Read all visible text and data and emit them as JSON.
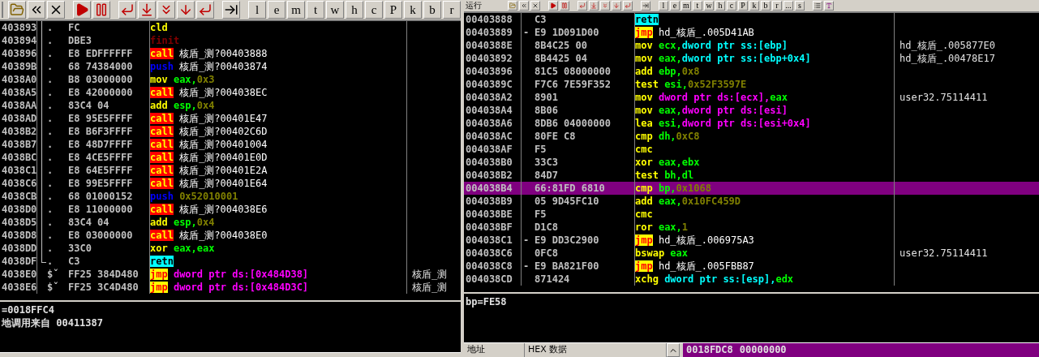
{
  "left_pane": {
    "toolbar": {
      "letters": [
        "l",
        "e",
        "m",
        "t",
        "w",
        "h",
        "c",
        "P",
        "k",
        "b",
        "r"
      ]
    },
    "rows": [
      {
        "address": "403893",
        "marker": {
          "text": ".",
          "kind": "block"
        },
        "bytes": "FC",
        "instruction": [
          {
            "text": "cld",
            "kind": "op"
          }
        ]
      },
      {
        "address": "403894",
        "marker": {
          "text": ".",
          "kind": "block"
        },
        "bytes": "DBE3",
        "instruction": [
          {
            "text": "finit",
            "kind": "fpu"
          }
        ]
      },
      {
        "address": "403896",
        "marker": {
          "text": ".",
          "kind": "block"
        },
        "bytes": "E8 EDFFFFFF",
        "instruction": [
          {
            "text": "call",
            "kind": "call"
          },
          {
            "text": " 核盾_测?00403888",
            "kind": "label"
          }
        ]
      },
      {
        "address": "40389B",
        "marker": {
          "text": ".",
          "kind": "block"
        },
        "bytes": "68 74384000",
        "instruction": [
          {
            "text": "push",
            "kind": "push"
          },
          {
            "text": " 核盾_测?00403874",
            "kind": "label"
          }
        ]
      },
      {
        "address": "4038A0",
        "marker": {
          "text": ".",
          "kind": "block"
        },
        "bytes": "B8 03000000",
        "instruction": [
          {
            "text": "mov",
            "kind": "op"
          },
          {
            "text": " eax,",
            "kind": "reg"
          },
          {
            "text": "0x3",
            "kind": "imm"
          }
        ]
      },
      {
        "address": "4038A5",
        "marker": {
          "text": ".",
          "kind": "block"
        },
        "bytes": "E8 42000000",
        "instruction": [
          {
            "text": "call",
            "kind": "call"
          },
          {
            "text": " 核盾_测?004038EC",
            "kind": "label"
          }
        ]
      },
      {
        "address": "4038AA",
        "marker": {
          "text": ".",
          "kind": "block"
        },
        "bytes": "83C4 04",
        "instruction": [
          {
            "text": "add",
            "kind": "op"
          },
          {
            "text": " esp,",
            "kind": "reg"
          },
          {
            "text": "0x4",
            "kind": "imm"
          }
        ]
      },
      {
        "address": "4038AD",
        "marker": {
          "text": ".",
          "kind": "block"
        },
        "bytes": "E8 95E5FFFF",
        "instruction": [
          {
            "text": "call",
            "kind": "call"
          },
          {
            "text": " 核盾_测?00401E47",
            "kind": "label"
          }
        ]
      },
      {
        "address": "4038B2",
        "marker": {
          "text": ".",
          "kind": "block"
        },
        "bytes": "E8 B6F3FFFF",
        "instruction": [
          {
            "text": "call",
            "kind": "call"
          },
          {
            "text": " 核盾_测?00402C6D",
            "kind": "label"
          }
        ]
      },
      {
        "address": "4038B7",
        "marker": {
          "text": ".",
          "kind": "block"
        },
        "bytes": "E8 48D7FFFF",
        "instruction": [
          {
            "text": "call",
            "kind": "call"
          },
          {
            "text": " 核盾_测?00401004",
            "kind": "label"
          }
        ]
      },
      {
        "address": "4038BC",
        "marker": {
          "text": ".",
          "kind": "block"
        },
        "bytes": "E8 4CE5FFFF",
        "instruction": [
          {
            "text": "call",
            "kind": "call"
          },
          {
            "text": " 核盾_测?00401E0D",
            "kind": "label"
          }
        ]
      },
      {
        "address": "4038C1",
        "marker": {
          "text": ".",
          "kind": "block"
        },
        "bytes": "E8 64E5FFFF",
        "instruction": [
          {
            "text": "call",
            "kind": "call"
          },
          {
            "text": " 核盾_测?00401E2A",
            "kind": "label"
          }
        ]
      },
      {
        "address": "4038C6",
        "marker": {
          "text": ".",
          "kind": "block"
        },
        "bytes": "E8 99E5FFFF",
        "instruction": [
          {
            "text": "call",
            "kind": "call"
          },
          {
            "text": " 核盾_测?00401E64",
            "kind": "label"
          }
        ]
      },
      {
        "address": "4038CB",
        "marker": {
          "text": ".",
          "kind": "block"
        },
        "bytes": "68 01000152",
        "instruction": [
          {
            "text": "push",
            "kind": "push"
          },
          {
            "text": " 0x52010001",
            "kind": "imm"
          }
        ]
      },
      {
        "address": "4038D0",
        "marker": {
          "text": ".",
          "kind": "block"
        },
        "bytes": "E8 11000000",
        "instruction": [
          {
            "text": "call",
            "kind": "call"
          },
          {
            "text": " 核盾_测?004038E6",
            "kind": "label"
          }
        ]
      },
      {
        "address": "4038D5",
        "marker": {
          "text": ".",
          "kind": "block"
        },
        "bytes": "83C4 04",
        "instruction": [
          {
            "text": "add",
            "kind": "op"
          },
          {
            "text": " esp,",
            "kind": "reg"
          },
          {
            "text": "0x4",
            "kind": "imm"
          }
        ]
      },
      {
        "address": "4038D8",
        "marker": {
          "text": ".",
          "kind": "block"
        },
        "bytes": "E8 03000000",
        "instruction": [
          {
            "text": "call",
            "kind": "call"
          },
          {
            "text": " 核盾_测?004038E0",
            "kind": "label"
          }
        ]
      },
      {
        "address": "4038DD",
        "marker": {
          "text": ".",
          "kind": "block"
        },
        "bytes": "33C0",
        "instruction": [
          {
            "text": "xor",
            "kind": "op"
          },
          {
            "text": " eax,eax",
            "kind": "reg"
          }
        ]
      },
      {
        "address": "4038DF",
        "marker": {
          "text": ".",
          "kind": "end"
        },
        "bytes": "C3",
        "instruction": [
          {
            "text": "retn",
            "kind": "retn"
          }
        ]
      },
      {
        "address": "4038E0",
        "marker": {
          "text": "$ˇ",
          "kind": "entry"
        },
        "bytes": "FF25 384D480",
        "instruction": [
          {
            "text": "jmp",
            "kind": "jmp"
          },
          {
            "text": " dword ptr ds:[0x484D38]",
            "kind": "mem"
          }
        ],
        "comment": "核盾_测"
      },
      {
        "address": "4038E6",
        "marker": {
          "text": "$ˇ",
          "kind": "entry"
        },
        "bytes": "FF25 3C4D480",
        "instruction": [
          {
            "text": "jmp",
            "kind": "jmp"
          },
          {
            "text": " dword ptr ds:[0x484D3C]",
            "kind": "mem"
          }
        ],
        "comment": "核盾_测"
      }
    ],
    "info": [
      "=0018FFC4",
      "地调用来自 00411387"
    ]
  },
  "right_pane": {
    "toolbar": {
      "status": "运行",
      "letters": [
        "l",
        "e",
        "m",
        "t",
        "w",
        "h",
        "c",
        "P",
        "k",
        "b",
        "r",
        "...",
        "s"
      ]
    },
    "rows": [
      {
        "address": "00403888",
        "bytes": "C3",
        "instruction": [
          {
            "text": "retn",
            "kind": "retn"
          }
        ],
        "selected": false
      },
      {
        "address": "00403889",
        "marker": {
          "text": "-",
          "kind": "jump"
        },
        "bytes": "E9 1D091D00",
        "instruction": [
          {
            "text": "jmp",
            "kind": "jmp"
          },
          {
            "text": " hd_核盾_.005D41AB",
            "kind": "label"
          }
        ],
        "selected": false
      },
      {
        "address": "0040388E",
        "bytes": "8B4C25 00",
        "instruction": [
          {
            "text": "mov",
            "kind": "op"
          },
          {
            "text": " ecx,",
            "kind": "reg"
          },
          {
            "text": "dword ptr ss:[ebp]",
            "kind": "stack"
          }
        ],
        "comment": "hd_核盾_.005877E0",
        "selected": false
      },
      {
        "address": "00403892",
        "bytes": "8B4425 04",
        "instruction": [
          {
            "text": "mov",
            "kind": "op"
          },
          {
            "text": " eax,",
            "kind": "reg"
          },
          {
            "text": "dword ptr ss:[ebp+0x4]",
            "kind": "stack"
          }
        ],
        "comment": "hd_核盾_.00478E17",
        "selected": false
      },
      {
        "address": "00403896",
        "bytes": "81C5 08000000",
        "instruction": [
          {
            "text": "add",
            "kind": "op"
          },
          {
            "text": " ebp,",
            "kind": "reg"
          },
          {
            "text": "0x8",
            "kind": "imm"
          }
        ],
        "selected": false
      },
      {
        "address": "0040389C",
        "bytes": "F7C6 7E59F352",
        "instruction": [
          {
            "text": "test",
            "kind": "op"
          },
          {
            "text": " esi,",
            "kind": "reg"
          },
          {
            "text": "0x52F3597E",
            "kind": "imm"
          }
        ],
        "selected": false
      },
      {
        "address": "004038A2",
        "bytes": "8901",
        "instruction": [
          {
            "text": "mov",
            "kind": "op"
          },
          {
            "text": " dword ptr ds:[ecx],",
            "kind": "mem"
          },
          {
            "text": "eax",
            "kind": "reg"
          }
        ],
        "comment": "user32.75114411",
        "selected": false
      },
      {
        "address": "004038A4",
        "bytes": "8B06",
        "instruction": [
          {
            "text": "mov",
            "kind": "op"
          },
          {
            "text": " eax,",
            "kind": "reg"
          },
          {
            "text": "dword ptr ds:[esi]",
            "kind": "mem"
          }
        ],
        "selected": false
      },
      {
        "address": "004038A6",
        "bytes": "8DB6 04000000",
        "instruction": [
          {
            "text": "lea",
            "kind": "op"
          },
          {
            "text": " esi,",
            "kind": "reg"
          },
          {
            "text": "dword ptr ds:[esi+0x4]",
            "kind": "mem"
          }
        ],
        "selected": false
      },
      {
        "address": "004038AC",
        "bytes": "80FE C8",
        "instruction": [
          {
            "text": "cmp",
            "kind": "op"
          },
          {
            "text": " dh,",
            "kind": "reg"
          },
          {
            "text": "0xC8",
            "kind": "imm"
          }
        ],
        "selected": false
      },
      {
        "address": "004038AF",
        "bytes": "F5",
        "instruction": [
          {
            "text": "cmc",
            "kind": "op"
          }
        ],
        "selected": false
      },
      {
        "address": "004038B0",
        "bytes": "33C3",
        "instruction": [
          {
            "text": "xor",
            "kind": "op"
          },
          {
            "text": " eax,ebx",
            "kind": "reg"
          }
        ],
        "selected": false
      },
      {
        "address": "004038B2",
        "bytes": "84D7",
        "instruction": [
          {
            "text": "test",
            "kind": "op"
          },
          {
            "text": " bh,dl",
            "kind": "reg"
          }
        ],
        "selected": false
      },
      {
        "address": "004038B4",
        "bytes": "66:81FD 6810",
        "instruction": [
          {
            "text": "cmp",
            "kind": "op"
          },
          {
            "text": " bp,",
            "kind": "reg"
          },
          {
            "text": "0x1068",
            "kind": "imm"
          }
        ],
        "selected": true
      },
      {
        "address": "004038B9",
        "bytes": "05 9D45FC10",
        "instruction": [
          {
            "text": "add",
            "kind": "op"
          },
          {
            "text": " eax,",
            "kind": "reg"
          },
          {
            "text": "0x10FC459D",
            "kind": "imm"
          }
        ],
        "selected": false
      },
      {
        "address": "004038BE",
        "bytes": "F5",
        "instruction": [
          {
            "text": "cmc",
            "kind": "op"
          }
        ],
        "selected": false
      },
      {
        "address": "004038BF",
        "bytes": "D1C8",
        "instruction": [
          {
            "text": "ror",
            "kind": "op"
          },
          {
            "text": " eax,",
            "kind": "reg"
          },
          {
            "text": "1",
            "kind": "imm"
          }
        ],
        "selected": false
      },
      {
        "address": "004038C1",
        "marker": {
          "text": "-",
          "kind": "jump"
        },
        "bytes": "E9 DD3C2900",
        "instruction": [
          {
            "text": "jmp",
            "kind": "jmp"
          },
          {
            "text": " hd_核盾_.006975A3",
            "kind": "label"
          }
        ],
        "selected": false
      },
      {
        "address": "004038C6",
        "bytes": "0FC8",
        "instruction": [
          {
            "text": "bswap",
            "kind": "op"
          },
          {
            "text": " eax",
            "kind": "reg"
          }
        ],
        "comment": "user32.75114411",
        "selected": false
      },
      {
        "address": "004038C8",
        "marker": {
          "text": "-",
          "kind": "jump"
        },
        "bytes": "E9 BA821F00",
        "instruction": [
          {
            "text": "jmp",
            "kind": "jmp"
          },
          {
            "text": " hd_核盾_.005FBB87",
            "kind": "label"
          }
        ],
        "selected": false
      },
      {
        "address": "004038CD",
        "bytes": "871424",
        "instruction": [
          {
            "text": "xchg",
            "kind": "op"
          },
          {
            "text": " dword ptr ss:[esp],",
            "kind": "stack"
          },
          {
            "text": "edx",
            "kind": "reg"
          }
        ],
        "selected": false
      }
    ],
    "info": [
      "bp=FE58"
    ],
    "dump": {
      "columns": [
        "地址",
        "HEX 数据"
      ],
      "address": "0018FDC8",
      "value": "00000000"
    }
  }
}
